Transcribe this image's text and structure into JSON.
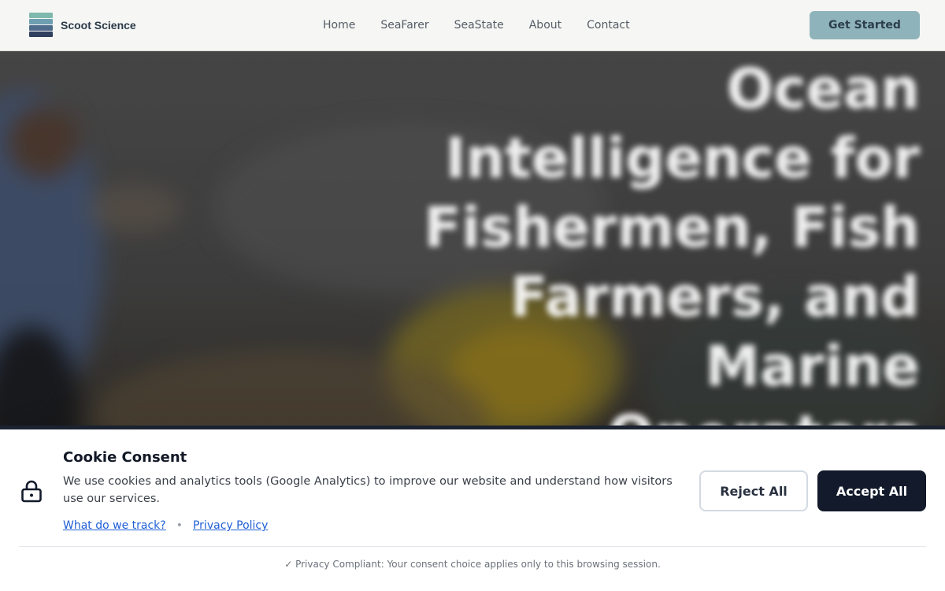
{
  "header": {
    "logo_text": "Scoot Science",
    "logo_colors": [
      "#7fb9ad",
      "#6d9fb0",
      "#4f6c8c",
      "#2f3f5e"
    ],
    "nav": [
      "Home",
      "SeaFarer",
      "SeaState",
      "About",
      "Contact"
    ],
    "cta_label": "Get Started",
    "cta_color": "#8fb3ba"
  },
  "hero": {
    "title": "Ocean Intelligence for Fishermen, Fish Farmers, and Marine Operators"
  },
  "cookie": {
    "icon": "lock-icon",
    "title": "Cookie Consent",
    "text": "We use cookies and analytics tools (Google Analytics) to improve our website and understand how visitors use our services.",
    "link_track": "What do we track?",
    "separator": "•",
    "link_privacy": "Privacy Policy",
    "reject_label": "Reject All",
    "accept_label": "Accept All",
    "accept_color": "#121a2b",
    "privacy_note": "✓ Privacy Compliant: Your consent choice applies only to this browsing session."
  }
}
